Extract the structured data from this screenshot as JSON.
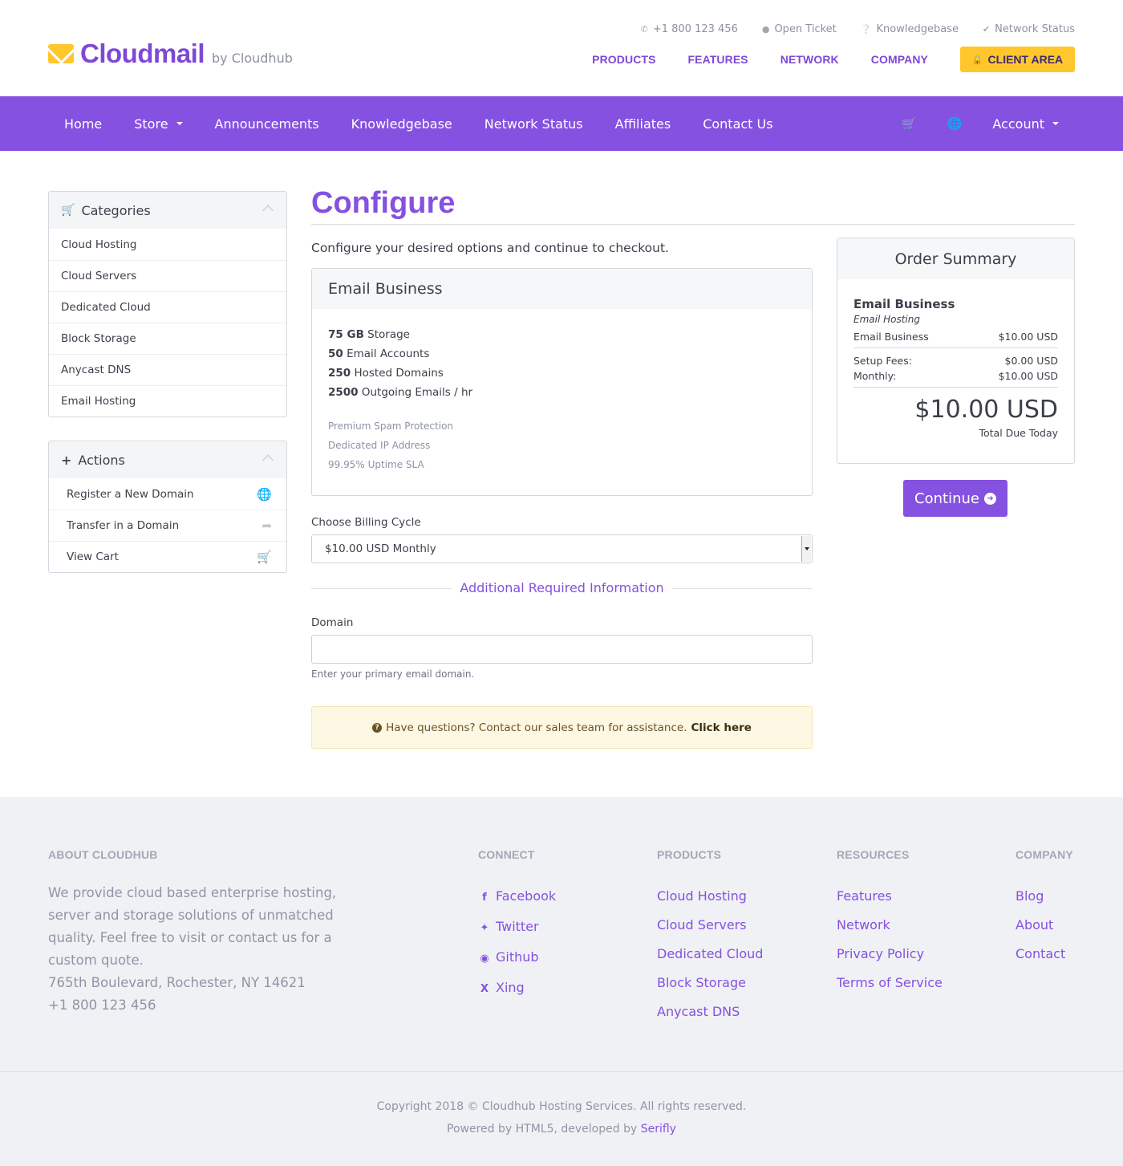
{
  "brand": {
    "name": "Cloudmail",
    "by": "by Cloudhub",
    "accent": "#8551e0",
    "highlight": "#ffc72c"
  },
  "utility_links": [
    {
      "icon": "phone-icon",
      "label": "+1 800 123 456"
    },
    {
      "icon": "chat-icon",
      "label": "Open Ticket"
    },
    {
      "icon": "question-icon",
      "label": "Knowledgebase"
    },
    {
      "icon": "check-icon",
      "label": "Network Status"
    }
  ],
  "main_nav": [
    "PRODUCTS",
    "FEATURES",
    "NETWORK",
    "COMPANY"
  ],
  "client_area": "CLIENT AREA",
  "purple_nav": {
    "items": [
      "Home",
      "Store",
      "Announcements",
      "Knowledgebase",
      "Network Status",
      "Affiliates",
      "Contact Us"
    ],
    "account": "Account"
  },
  "sidebar": {
    "categories_title": "Categories",
    "categories": [
      "Cloud Hosting",
      "Cloud Servers",
      "Dedicated Cloud",
      "Block Storage",
      "Anycast DNS",
      "Email Hosting"
    ],
    "actions_title": "Actions",
    "actions": [
      {
        "label": "Register a New Domain",
        "icon": "globe-icon"
      },
      {
        "label": "Transfer in a Domain",
        "icon": "share-icon"
      },
      {
        "label": "View Cart",
        "icon": "cart-icon"
      }
    ]
  },
  "main": {
    "title": "Configure",
    "intro": "Configure your desired options and continue to checkout.",
    "product": {
      "name": "Email Business",
      "features": [
        {
          "value": "75 GB",
          "label": " Storage"
        },
        {
          "value": "50",
          "label": " Email Accounts"
        },
        {
          "value": "250",
          "label": " Hosted Domains"
        },
        {
          "value": "2500",
          "label": " Outgoing Emails / hr"
        }
      ],
      "extras": [
        "Premium Spam Protection",
        "Dedicated IP Address",
        "99.95% Uptime SLA"
      ]
    },
    "billing_label": "Choose Billing Cycle",
    "billing_value": "$10.00 USD Monthly",
    "additional_title": "Additional Required Information",
    "domain_label": "Domain",
    "domain_value": "",
    "domain_help": "Enter your primary email domain.",
    "alert_text": "Have questions? Contact our sales team for assistance.",
    "alert_link": "Click here"
  },
  "summary": {
    "title": "Order Summary",
    "product": "Email Business",
    "group": "Email Hosting",
    "line_label": "Email Business",
    "line_price": "$10.00 USD",
    "setup_label": "Setup Fees:",
    "setup_value": "$0.00 USD",
    "monthly_label": "Monthly:",
    "monthly_value": "$10.00 USD",
    "total": "$10.00 USD",
    "total_label": "Total Due Today",
    "continue": "Continue"
  },
  "footer": {
    "about_title": "ABOUT CLOUDHUB",
    "about_text": "We provide cloud based enterprise hosting, server and storage solutions of unmatched quality. Feel free to visit or contact us for a custom quote.",
    "address": "765th Boulevard, Rochester, NY 14621",
    "phone": "+1 800 123 456",
    "connect_title": "CONNECT",
    "connect": [
      {
        "label": "Facebook",
        "icon": "facebook-icon"
      },
      {
        "label": "Twitter",
        "icon": "twitter-icon"
      },
      {
        "label": "Github",
        "icon": "github-icon"
      },
      {
        "label": "Xing",
        "icon": "xing-icon"
      }
    ],
    "products_title": "PRODUCTS",
    "products": [
      "Cloud Hosting",
      "Cloud Servers",
      "Dedicated Cloud",
      "Block Storage",
      "Anycast DNS"
    ],
    "resources_title": "RESOURCES",
    "resources": [
      "Features",
      "Network",
      "Privacy Policy",
      "Terms of Service"
    ],
    "company_title": "COMPANY",
    "company": [
      "Blog",
      "About",
      "Contact"
    ],
    "copyright": "Copyright 2018 © Cloudhub Hosting Services. All rights reserved.",
    "powered_prefix": "Powered by HTML5, developed by ",
    "powered_link": "Serifly"
  }
}
